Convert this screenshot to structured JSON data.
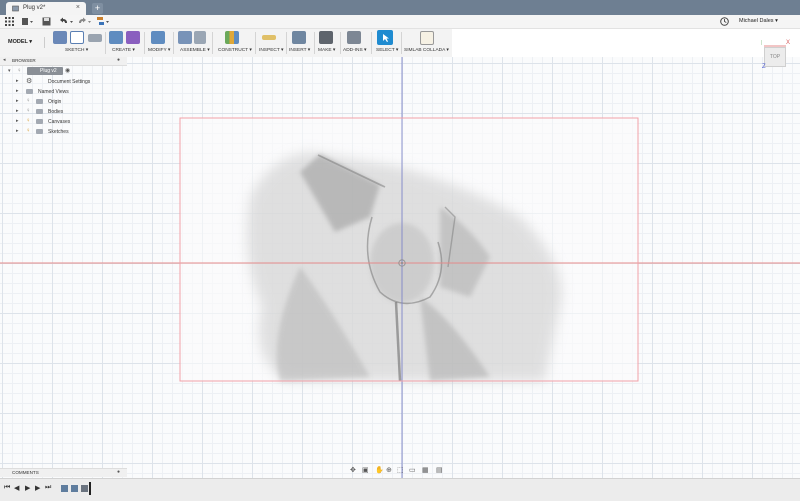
{
  "tab": {
    "title": "Plug v2*",
    "close": "×",
    "new_tab": "+"
  },
  "quick_access": {
    "user_name": "Michael Dales ▾"
  },
  "toolbar": {
    "workspace": "MODEL ▾",
    "groups": [
      {
        "id": "sketch",
        "label": "SKETCH ▾"
      },
      {
        "id": "create",
        "label": "CREATE ▾"
      },
      {
        "id": "modify",
        "label": "MODIFY ▾"
      },
      {
        "id": "assemble",
        "label": "ASSEMBLE ▾"
      },
      {
        "id": "construct",
        "label": "CONSTRUCT ▾"
      },
      {
        "id": "inspect",
        "label": "INSPECT ▾"
      },
      {
        "id": "insert",
        "label": "INSERT ▾"
      },
      {
        "id": "make",
        "label": "MAKE ▾"
      },
      {
        "id": "addins",
        "label": "ADD-INS ▾"
      },
      {
        "id": "select",
        "label": "SELECT ▾"
      },
      {
        "id": "simlab",
        "label": "SIMLAB COLLADA ▾"
      }
    ]
  },
  "browser": {
    "title": "BROWSER",
    "root": "Plug v2",
    "items": [
      {
        "label": "Document Settings"
      },
      {
        "label": "Named Views"
      },
      {
        "label": "Origin"
      },
      {
        "label": "Bodies"
      },
      {
        "label": "Canvases"
      },
      {
        "label": "Sketches"
      }
    ]
  },
  "comments": {
    "title": "COMMENTS"
  },
  "viewcube": {
    "face": "TOP",
    "axis_x": "X",
    "axis_z": "Z"
  },
  "colors": {
    "tabbar": "#6e7f92",
    "accent_select": "#1f8bd0",
    "x_axis": "#e58b8b",
    "z_axis": "#7f86c9",
    "canvas_outline": "#f2a0a8"
  },
  "icons": [
    "grid-icon",
    "file-icon",
    "save-icon",
    "undo-icon",
    "redo-icon",
    "clock-icon",
    "timeline-play-icon"
  ]
}
